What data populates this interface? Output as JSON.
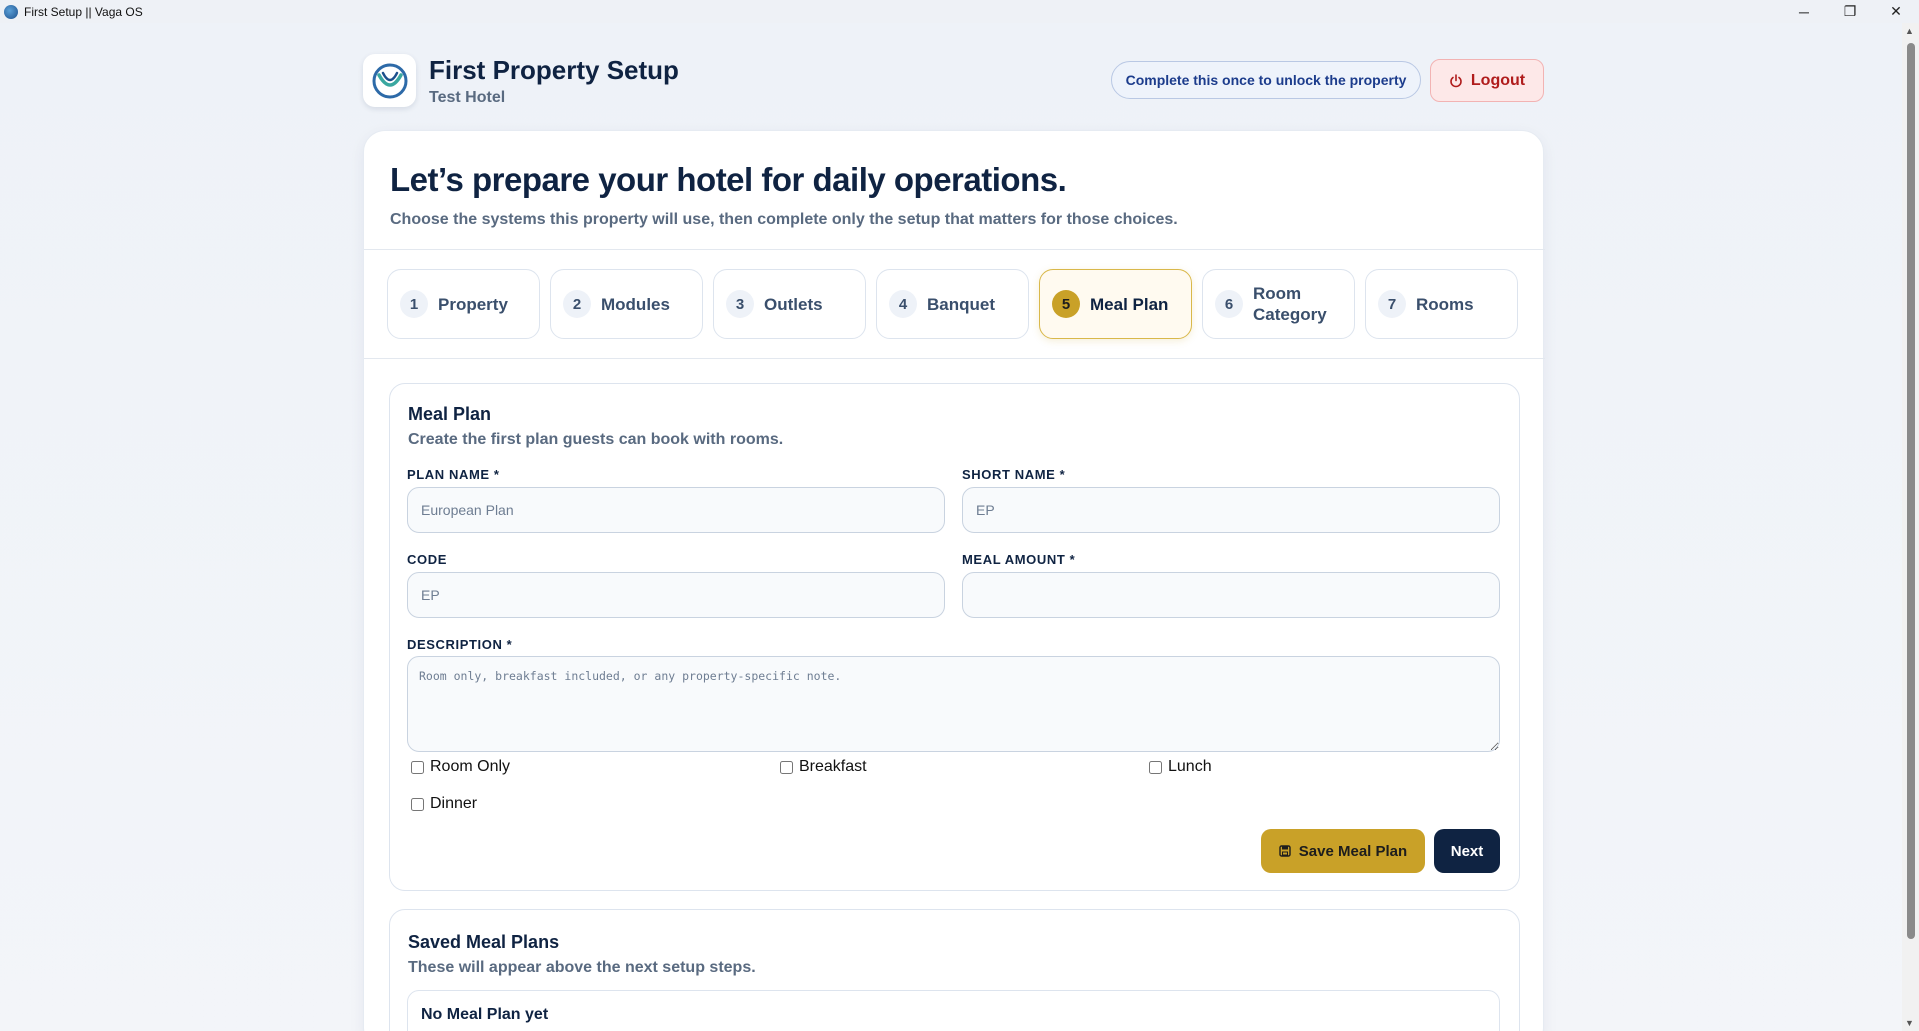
{
  "window": {
    "title": "First Setup || Vaga OS",
    "minimize": "─",
    "maximize": "❐",
    "close": "✕"
  },
  "header": {
    "title": "First Property Setup",
    "subtitle": "Test Hotel",
    "note": "Complete this once to unlock the property",
    "logout_label": "Logout",
    "logout_icon": "power-icon"
  },
  "hero": {
    "heading": "Let’s prepare your hotel for daily operations.",
    "description": "Choose the systems this property will use, then complete only the setup that matters for those choices."
  },
  "steps": [
    {
      "num": "1",
      "label": "Property"
    },
    {
      "num": "2",
      "label": "Modules"
    },
    {
      "num": "3",
      "label": "Outlets"
    },
    {
      "num": "4",
      "label": "Banquet"
    },
    {
      "num": "5",
      "label": "Meal Plan",
      "active": true
    },
    {
      "num": "6",
      "label": "Room Category"
    },
    {
      "num": "7",
      "label": "Rooms"
    }
  ],
  "form": {
    "title": "Meal Plan",
    "subtitle": "Create the first plan guests can book with rooms.",
    "plan_name": {
      "label": "PLAN NAME *",
      "placeholder": "European Plan",
      "value": ""
    },
    "short_name": {
      "label": "SHORT NAME *",
      "placeholder": "EP",
      "value": ""
    },
    "code": {
      "label": "CODE",
      "placeholder": "EP",
      "value": ""
    },
    "meal_amount": {
      "label": "MEAL AMOUNT *",
      "placeholder": "",
      "value": ""
    },
    "description": {
      "label": "DESCRIPTION *",
      "placeholder": "Room only, breakfast included, or any property-specific note.",
      "value": ""
    },
    "checkboxes": [
      {
        "label": "Room Only",
        "checked": false
      },
      {
        "label": "Breakfast",
        "checked": false
      },
      {
        "label": "Lunch",
        "checked": false
      },
      {
        "label": "Dinner",
        "checked": false
      }
    ],
    "save_label": "Save Meal Plan",
    "save_icon": "save-icon",
    "next_label": "Next"
  },
  "saved": {
    "title": "Saved Meal Plans",
    "subtitle": "These will appear above the next setup steps.",
    "empty": "No Meal Plan yet"
  }
}
